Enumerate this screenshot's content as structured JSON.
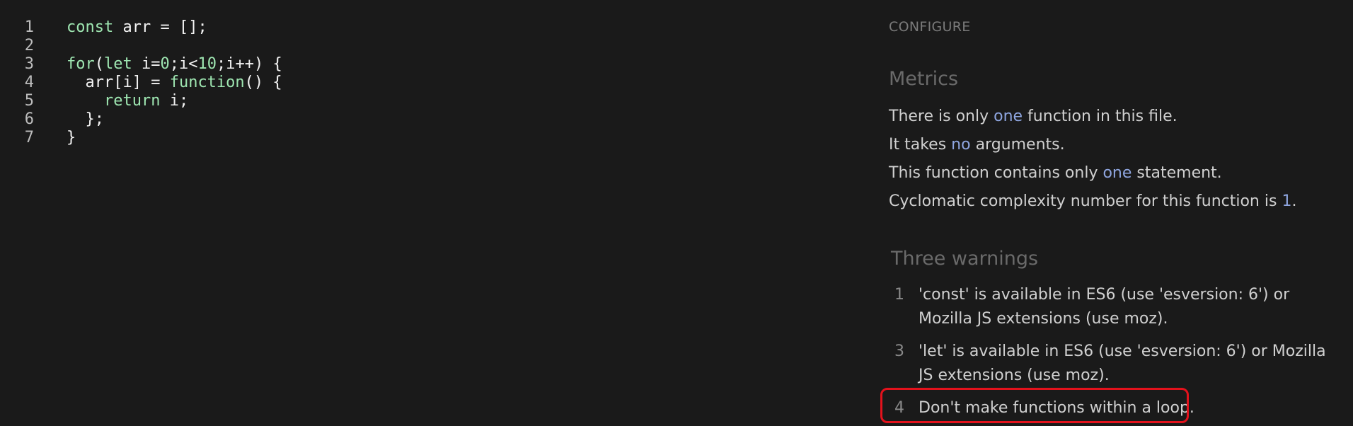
{
  "editor": {
    "lines": [
      {
        "num": "1",
        "tokens": [
          {
            "t": "const",
            "c": "kw"
          },
          {
            "t": " arr = ",
            "c": "plain"
          },
          {
            "t": "[];",
            "c": "plain"
          }
        ]
      },
      {
        "num": "2",
        "tokens": []
      },
      {
        "num": "3",
        "tokens": [
          {
            "t": "for",
            "c": "kw"
          },
          {
            "t": "(",
            "c": "plain"
          },
          {
            "t": "let",
            "c": "kw"
          },
          {
            "t": " i=",
            "c": "plain"
          },
          {
            "t": "0",
            "c": "num"
          },
          {
            "t": ";i<",
            "c": "plain"
          },
          {
            "t": "10",
            "c": "num"
          },
          {
            "t": ";i++) {",
            "c": "plain"
          }
        ]
      },
      {
        "num": "4",
        "tokens": [
          {
            "t": "  arr[i] = ",
            "c": "plain"
          },
          {
            "t": "function",
            "c": "fn"
          },
          {
            "t": "() {",
            "c": "plain"
          }
        ]
      },
      {
        "num": "5",
        "tokens": [
          {
            "t": "    ",
            "c": "plain"
          },
          {
            "t": "return",
            "c": "kw"
          },
          {
            "t": " i;",
            "c": "plain"
          }
        ]
      },
      {
        "num": "6",
        "tokens": [
          {
            "t": "  };",
            "c": "plain"
          }
        ]
      },
      {
        "num": "7",
        "tokens": [
          {
            "t": "}",
            "c": "plain"
          }
        ]
      }
    ]
  },
  "panel": {
    "configure_label": "CONFIGURE",
    "metrics_title": "Metrics",
    "metrics": [
      {
        "before": "There is only ",
        "highlight": "one",
        "after": " function in this file."
      },
      {
        "before": "It takes ",
        "highlight": "no",
        "after": " arguments."
      },
      {
        "before": "This function contains only ",
        "highlight": "one",
        "after": " statement."
      },
      {
        "before": "Cyclomatic complexity number for this function is ",
        "highlight": "1",
        "after": "."
      }
    ],
    "warnings_title": "Three warnings",
    "warnings": [
      {
        "line": "1",
        "text": "'const' is available in ES6 (use 'esversion: 6') or Mozilla JS extensions (use moz)."
      },
      {
        "line": "3",
        "text": "'let' is available in ES6 (use 'esversion: 6') or Mozilla JS extensions (use moz)."
      },
      {
        "line": "4",
        "text": "Don't make functions within a loop."
      }
    ]
  },
  "colors": {
    "background": "#1a1a1a",
    "keyword": "#9ee6b1",
    "highlight": "#8fa6e0",
    "annotation_box": "#e3121c"
  }
}
